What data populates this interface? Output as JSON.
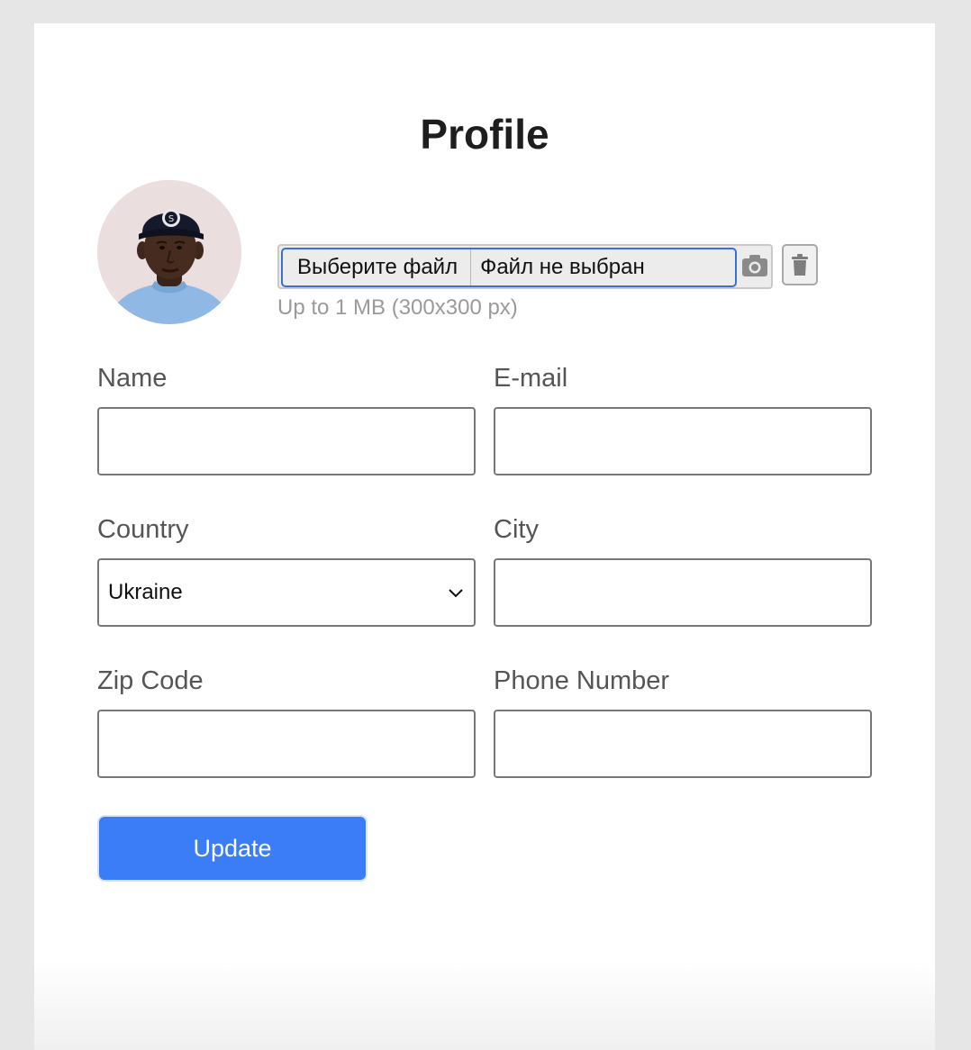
{
  "page": {
    "title": "Profile"
  },
  "avatar": {
    "icon": "avatar-photo"
  },
  "upload": {
    "choose_file_label": "Выберите файл",
    "file_status": "Файл не выбран",
    "camera_icon": "camera-icon",
    "delete_icon": "trash-icon",
    "hint": "Up to 1 MB (300x300 px)"
  },
  "form": {
    "name": {
      "label": "Name",
      "value": ""
    },
    "email": {
      "label": "E-mail",
      "value": ""
    },
    "country": {
      "label": "Country",
      "value": "Ukraine",
      "icon": "chevron-down-icon"
    },
    "city": {
      "label": "City",
      "value": ""
    },
    "zip": {
      "label": "Zip Code",
      "value": ""
    },
    "phone": {
      "label": "Phone Number",
      "value": ""
    }
  },
  "actions": {
    "update_label": "Update"
  },
  "colors": {
    "page_background": "#e6e6e6",
    "card_background": "#ffffff",
    "accent": "#3b7df7",
    "focus_ring": "#3b6fd1",
    "label_text": "#555555",
    "hint_text": "#9a9a9a"
  }
}
